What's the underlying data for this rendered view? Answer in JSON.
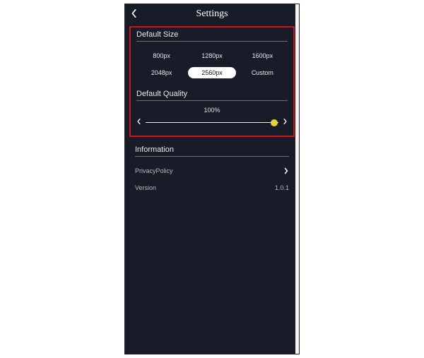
{
  "title": "Settings",
  "defaultSize": {
    "label": "Default Size",
    "options": [
      "800px",
      "1280px",
      "1600px",
      "2048px",
      "2560px",
      "Custom"
    ],
    "selectedIndex": 4
  },
  "defaultQuality": {
    "label": "Default Quality",
    "valueText": "100%",
    "valuePct": 100
  },
  "information": {
    "label": "Information",
    "privacyLabel": "PrivacyPolicy",
    "versionLabel": "Version",
    "versionValue": "1.0.1"
  }
}
